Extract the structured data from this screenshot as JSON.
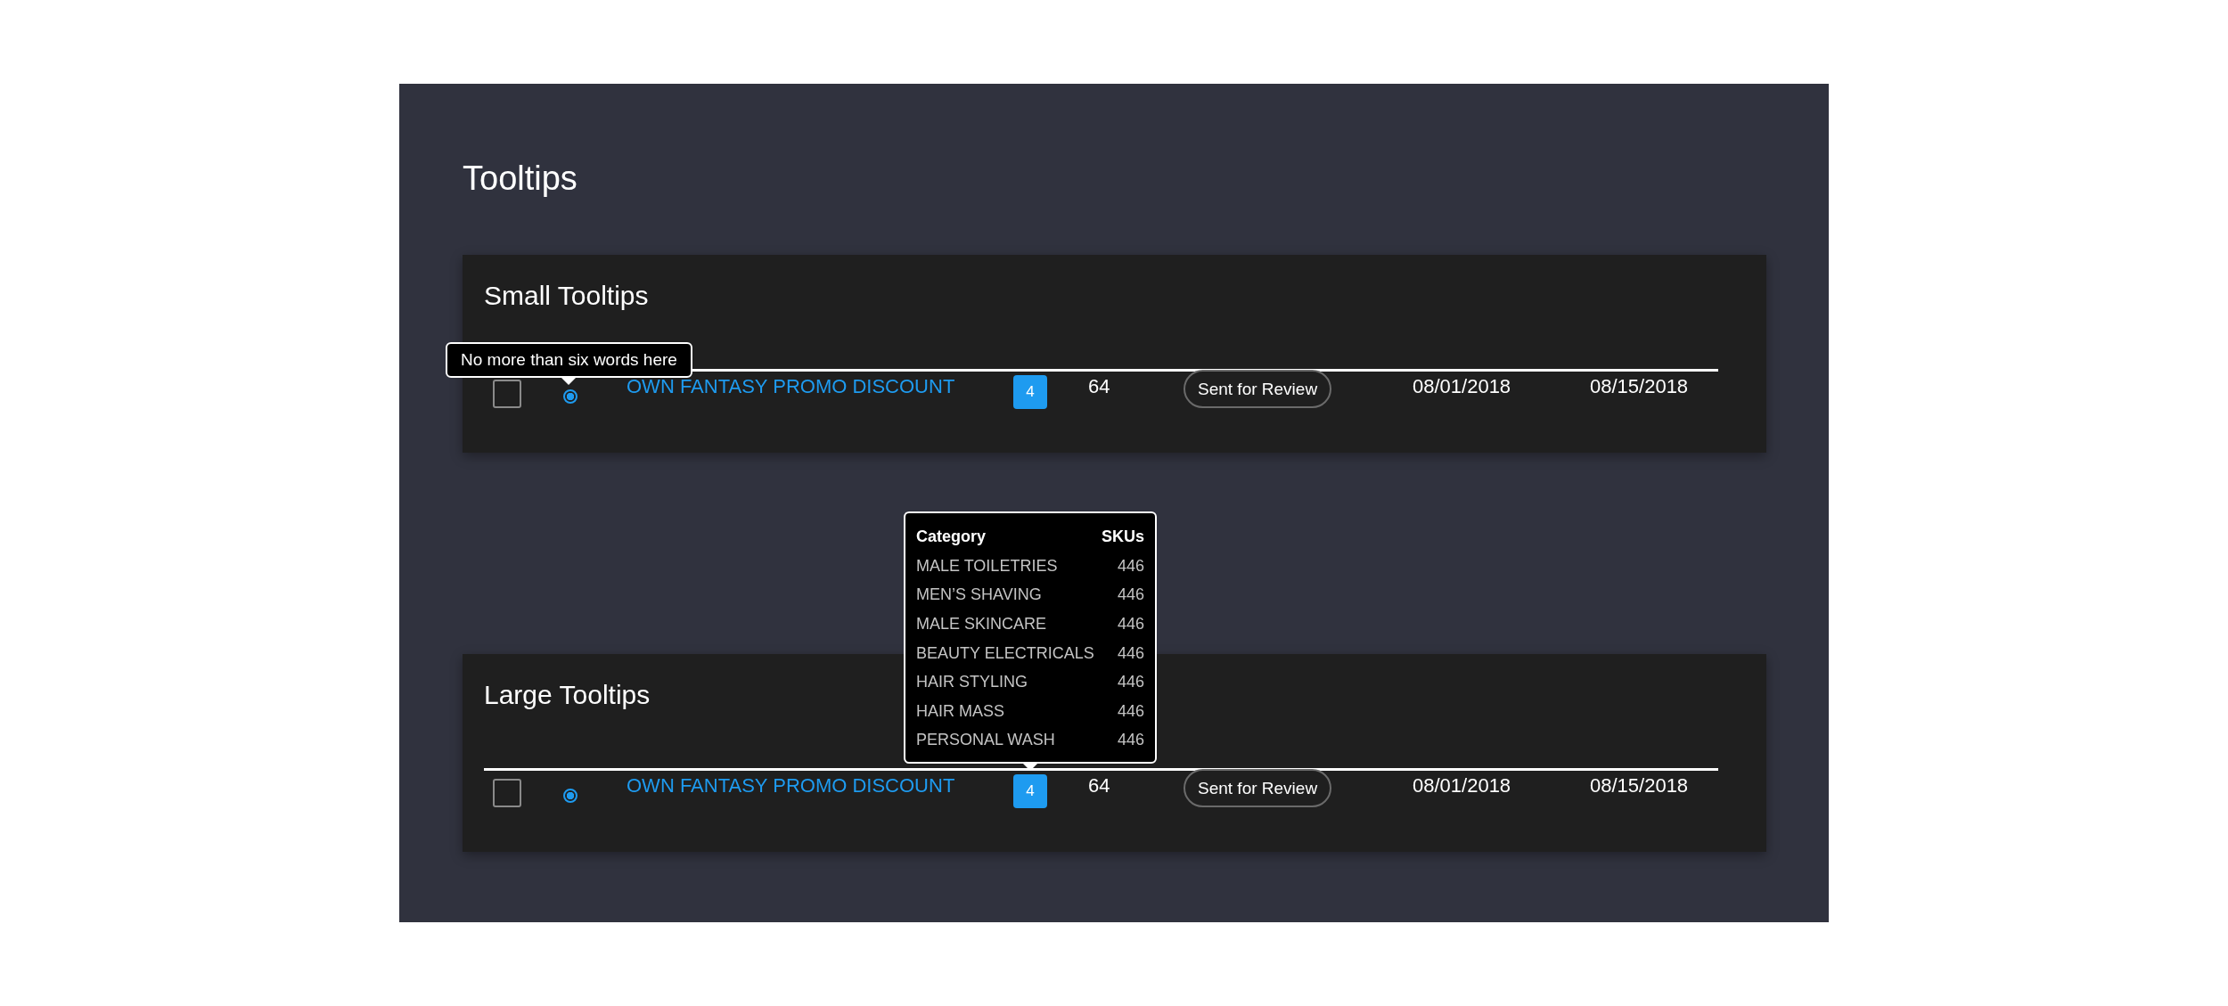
{
  "page_title": "Tooltips",
  "sections": [
    {
      "title": "Small Tooltips",
      "tooltip": {
        "kind": "small",
        "text": "No more than six words here"
      },
      "row": {
        "checked": false,
        "radio_selected": true,
        "name": "OWN FANTASY PROMO DISCOUNT",
        "badge": "4",
        "count": "64",
        "status": "Sent for Review",
        "start_date": "08/01/2018",
        "end_date": "08/15/2018"
      }
    },
    {
      "title": "Large Tooltips",
      "tooltip": {
        "kind": "table",
        "columns": [
          "Category",
          "SKUs"
        ],
        "rows": [
          [
            "MALE TOILETRIES",
            "446"
          ],
          [
            "MEN’S SHAVING",
            "446"
          ],
          [
            "MALE SKINCARE",
            "446"
          ],
          [
            "BEAUTY ELECTRICALS",
            "446"
          ],
          [
            "HAIR STYLING",
            "446"
          ],
          [
            "HAIR MASS",
            "446"
          ],
          [
            "PERSONAL WASH",
            "446"
          ]
        ]
      },
      "row": {
        "checked": false,
        "radio_selected": true,
        "name": "OWN FANTASY PROMO DISCOUNT",
        "badge": "4",
        "count": "64",
        "status": "Sent for Review",
        "start_date": "08/01/2018",
        "end_date": "08/15/2018"
      }
    }
  ]
}
